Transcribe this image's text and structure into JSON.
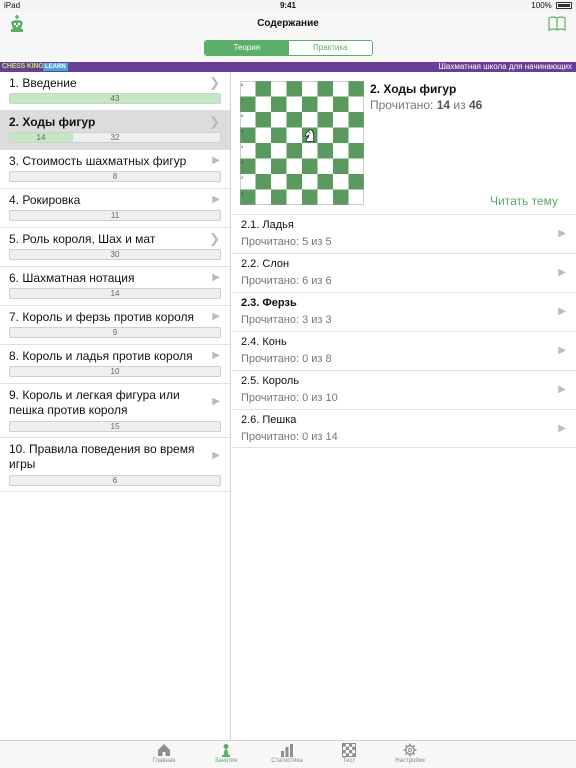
{
  "status": {
    "device": "iPad",
    "time": "9:41",
    "battery": "100%"
  },
  "nav": {
    "title": "Содержание"
  },
  "segments": [
    {
      "label": "Теория",
      "active": true
    },
    {
      "label": "Практика",
      "active": false
    }
  ],
  "banner": {
    "brand": "CHESS KING",
    "learn": "LEARN",
    "tagline": "Шахматная школа для начинающих"
  },
  "colors": {
    "accent": "#5cae6b",
    "banner": "#6b3e96",
    "board_dark": "#5a9a5e",
    "board_light": "#ffffff",
    "progress_fill": "#c3e6c3"
  },
  "lessons": [
    {
      "title": "1. Введение",
      "count": "43",
      "done": 43,
      "total": 43,
      "icon": "chevron-right-icon"
    },
    {
      "title": "2. Ходы фигур",
      "count": "14",
      "total_label": "32",
      "done": 14,
      "total": 46,
      "icon": "chevron-right-icon"
    },
    {
      "title": "3. Стоимость шахматных фигур",
      "count": "8",
      "done": 0,
      "total": 8,
      "icon": "play-arrow-icon"
    },
    {
      "title": "4. Рокировка",
      "count": "11",
      "done": 0,
      "total": 11,
      "icon": "play-arrow-icon"
    },
    {
      "title": "5. Роль короля, Шах и мат",
      "count": "30",
      "done": 0,
      "total": 30,
      "icon": "chevron-right-icon"
    },
    {
      "title": "6. Шахматная нотация",
      "count": "14",
      "done": 0,
      "total": 14,
      "icon": "play-arrow-icon"
    },
    {
      "title": "7. Король и ферзь против короля",
      "count": "9",
      "done": 0,
      "total": 9,
      "icon": "play-arrow-icon"
    },
    {
      "title": "8. Король и ладья против короля",
      "count": "10",
      "done": 0,
      "total": 10,
      "icon": "play-arrow-icon"
    },
    {
      "title": "9. Король и легкая фигура или пешка против короля",
      "count": "15",
      "done": 0,
      "total": 15,
      "icon": "play-arrow-icon"
    },
    {
      "title": "10. Правила поведения во время игры",
      "count": "6",
      "done": 0,
      "total": 6,
      "icon": "play-arrow-icon"
    }
  ],
  "detail": {
    "title": "2. Ходы фигур",
    "read_prefix": "Прочитано:",
    "read_done": "14",
    "read_of": "из",
    "read_total": "46",
    "read_topic": "Читать тему",
    "board_piece": "white-knight-icon",
    "board_ranks": [
      "8",
      "7",
      "6",
      "5",
      "4",
      "3",
      "2",
      "1"
    ]
  },
  "topics": [
    {
      "title": "2.1. Ладья",
      "read": "Прочитано: 5 из 5",
      "bold": false
    },
    {
      "title": "2.2. Слон",
      "read": "Прочитано: 6 из 6",
      "bold": false
    },
    {
      "title": "2.3. Ферзь",
      "read": "Прочитано: 3 из 3",
      "bold": true
    },
    {
      "title": "2.4. Конь",
      "read": "Прочитано: 0 из 8",
      "bold": false
    },
    {
      "title": "2.5. Король",
      "read": "Прочитано: 0 из 10",
      "bold": false
    },
    {
      "title": "2.6. Пешка",
      "read": "Прочитано: 0 из 14",
      "bold": false
    }
  ],
  "tabs": [
    {
      "label": "Главная",
      "icon": "home-icon",
      "active": false
    },
    {
      "label": "Занятия",
      "icon": "pawn-icon",
      "active": true
    },
    {
      "label": "Статистика",
      "icon": "bar-chart-icon",
      "active": false
    },
    {
      "label": "Тест",
      "icon": "chessboard-icon",
      "active": false
    },
    {
      "label": "Настройки",
      "icon": "gear-icon",
      "active": false
    }
  ]
}
